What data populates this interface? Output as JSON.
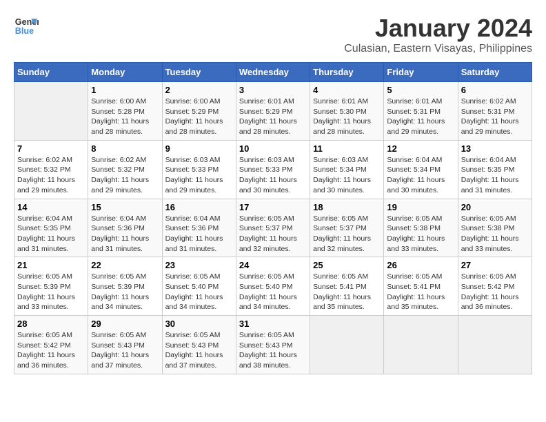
{
  "logo": {
    "line1": "General",
    "line2": "Blue"
  },
  "title": "January 2024",
  "subtitle": "Culasian, Eastern Visayas, Philippines",
  "days_of_week": [
    "Sunday",
    "Monday",
    "Tuesday",
    "Wednesday",
    "Thursday",
    "Friday",
    "Saturday"
  ],
  "weeks": [
    [
      {
        "day": "",
        "info": ""
      },
      {
        "day": "1",
        "info": "Sunrise: 6:00 AM\nSunset: 5:28 PM\nDaylight: 11 hours\nand 28 minutes."
      },
      {
        "day": "2",
        "info": "Sunrise: 6:00 AM\nSunset: 5:29 PM\nDaylight: 11 hours\nand 28 minutes."
      },
      {
        "day": "3",
        "info": "Sunrise: 6:01 AM\nSunset: 5:29 PM\nDaylight: 11 hours\nand 28 minutes."
      },
      {
        "day": "4",
        "info": "Sunrise: 6:01 AM\nSunset: 5:30 PM\nDaylight: 11 hours\nand 28 minutes."
      },
      {
        "day": "5",
        "info": "Sunrise: 6:01 AM\nSunset: 5:31 PM\nDaylight: 11 hours\nand 29 minutes."
      },
      {
        "day": "6",
        "info": "Sunrise: 6:02 AM\nSunset: 5:31 PM\nDaylight: 11 hours\nand 29 minutes."
      }
    ],
    [
      {
        "day": "7",
        "info": "Sunrise: 6:02 AM\nSunset: 5:32 PM\nDaylight: 11 hours\nand 29 minutes."
      },
      {
        "day": "8",
        "info": "Sunrise: 6:02 AM\nSunset: 5:32 PM\nDaylight: 11 hours\nand 29 minutes."
      },
      {
        "day": "9",
        "info": "Sunrise: 6:03 AM\nSunset: 5:33 PM\nDaylight: 11 hours\nand 29 minutes."
      },
      {
        "day": "10",
        "info": "Sunrise: 6:03 AM\nSunset: 5:33 PM\nDaylight: 11 hours\nand 30 minutes."
      },
      {
        "day": "11",
        "info": "Sunrise: 6:03 AM\nSunset: 5:34 PM\nDaylight: 11 hours\nand 30 minutes."
      },
      {
        "day": "12",
        "info": "Sunrise: 6:04 AM\nSunset: 5:34 PM\nDaylight: 11 hours\nand 30 minutes."
      },
      {
        "day": "13",
        "info": "Sunrise: 6:04 AM\nSunset: 5:35 PM\nDaylight: 11 hours\nand 31 minutes."
      }
    ],
    [
      {
        "day": "14",
        "info": "Sunrise: 6:04 AM\nSunset: 5:35 PM\nDaylight: 11 hours\nand 31 minutes."
      },
      {
        "day": "15",
        "info": "Sunrise: 6:04 AM\nSunset: 5:36 PM\nDaylight: 11 hours\nand 31 minutes."
      },
      {
        "day": "16",
        "info": "Sunrise: 6:04 AM\nSunset: 5:36 PM\nDaylight: 11 hours\nand 31 minutes."
      },
      {
        "day": "17",
        "info": "Sunrise: 6:05 AM\nSunset: 5:37 PM\nDaylight: 11 hours\nand 32 minutes."
      },
      {
        "day": "18",
        "info": "Sunrise: 6:05 AM\nSunset: 5:37 PM\nDaylight: 11 hours\nand 32 minutes."
      },
      {
        "day": "19",
        "info": "Sunrise: 6:05 AM\nSunset: 5:38 PM\nDaylight: 11 hours\nand 33 minutes."
      },
      {
        "day": "20",
        "info": "Sunrise: 6:05 AM\nSunset: 5:38 PM\nDaylight: 11 hours\nand 33 minutes."
      }
    ],
    [
      {
        "day": "21",
        "info": "Sunrise: 6:05 AM\nSunset: 5:39 PM\nDaylight: 11 hours\nand 33 minutes."
      },
      {
        "day": "22",
        "info": "Sunrise: 6:05 AM\nSunset: 5:39 PM\nDaylight: 11 hours\nand 34 minutes."
      },
      {
        "day": "23",
        "info": "Sunrise: 6:05 AM\nSunset: 5:40 PM\nDaylight: 11 hours\nand 34 minutes."
      },
      {
        "day": "24",
        "info": "Sunrise: 6:05 AM\nSunset: 5:40 PM\nDaylight: 11 hours\nand 34 minutes."
      },
      {
        "day": "25",
        "info": "Sunrise: 6:05 AM\nSunset: 5:41 PM\nDaylight: 11 hours\nand 35 minutes."
      },
      {
        "day": "26",
        "info": "Sunrise: 6:05 AM\nSunset: 5:41 PM\nDaylight: 11 hours\nand 35 minutes."
      },
      {
        "day": "27",
        "info": "Sunrise: 6:05 AM\nSunset: 5:42 PM\nDaylight: 11 hours\nand 36 minutes."
      }
    ],
    [
      {
        "day": "28",
        "info": "Sunrise: 6:05 AM\nSunset: 5:42 PM\nDaylight: 11 hours\nand 36 minutes."
      },
      {
        "day": "29",
        "info": "Sunrise: 6:05 AM\nSunset: 5:43 PM\nDaylight: 11 hours\nand 37 minutes."
      },
      {
        "day": "30",
        "info": "Sunrise: 6:05 AM\nSunset: 5:43 PM\nDaylight: 11 hours\nand 37 minutes."
      },
      {
        "day": "31",
        "info": "Sunrise: 6:05 AM\nSunset: 5:43 PM\nDaylight: 11 hours\nand 38 minutes."
      },
      {
        "day": "",
        "info": ""
      },
      {
        "day": "",
        "info": ""
      },
      {
        "day": "",
        "info": ""
      }
    ]
  ]
}
